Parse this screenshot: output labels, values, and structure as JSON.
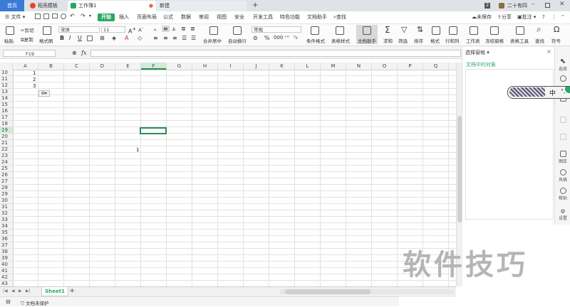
{
  "titlebar": {
    "tabs": [
      {
        "label": "首页"
      },
      {
        "label": "稻壳模板"
      },
      {
        "label": "工作簿1"
      },
      {
        "label": "新建"
      }
    ],
    "tab_count": "2",
    "user_name": "二十有四"
  },
  "menu": {
    "file_label": "文件",
    "items": [
      "开始",
      "插入",
      "页面布局",
      "公式",
      "数据",
      "审阅",
      "视图",
      "安全",
      "开发工具",
      "特色功能",
      "文档助手"
    ],
    "search_label": "查找",
    "unsaved_label": "未保存",
    "share_label": "分享",
    "comment_label": "批注"
  },
  "toolbar": {
    "paste": "粘贴",
    "cut": "剪切",
    "copy": "复制",
    "format_painter": "格式刷",
    "font_name": "宋体",
    "font_size": "11",
    "merge_center": "合并居中",
    "wrap_text": "自动换行",
    "number_format": "常规",
    "conditional_format": "条件格式",
    "table_style": "表格样式",
    "doc_assistant": "文档助手",
    "sum": "求和",
    "filter": "筛选",
    "sort": "排序",
    "format": "格式",
    "row_col": "行和列",
    "worksheet": "工作表",
    "freeze": "冻结窗格",
    "table_tools": "表格工具",
    "find": "查找",
    "symbol": "符号"
  },
  "formula_bar": {
    "name_box": "F19",
    "fx": "fx",
    "formula": ""
  },
  "grid": {
    "columns": [
      "A",
      "B",
      "C",
      "D",
      "E",
      "F",
      "G",
      "H",
      "I",
      "J",
      "K",
      "L",
      "M",
      "N",
      "O",
      "P",
      "Q"
    ],
    "rows": [
      "10",
      "11",
      "12",
      "13",
      "14",
      "15",
      "16",
      "17",
      "18",
      "19",
      "20",
      "21",
      "22",
      "23",
      "24",
      "25",
      "26",
      "27",
      "28",
      "29",
      "30",
      "31",
      "32",
      "33",
      "34",
      "35",
      "36",
      "37",
      "38",
      "39",
      "40",
      "41",
      "42",
      "43"
    ],
    "cells": [
      {
        "ref": "A10",
        "value": "1"
      },
      {
        "ref": "A11",
        "value": "2"
      },
      {
        "ref": "A12",
        "value": "3"
      },
      {
        "ref": "E22",
        "value": "1"
      }
    ],
    "selected_cell": "F19",
    "selected_column": "F",
    "selected_row": "19"
  },
  "sheets": {
    "active": "Sheet1",
    "add": "+"
  },
  "status": {
    "doc_protect": "文档未保护"
  },
  "side_panel": {
    "title": "选择窗格",
    "subtitle": "文档中的对象",
    "close": "×"
  },
  "side_toolbar": {
    "items": [
      {
        "label": "选择",
        "icon": "cursor-icon"
      },
      {
        "label": "图库",
        "icon": "image-icon"
      },
      {
        "label": "风格",
        "icon": "style-icon"
      },
      {
        "label": "帮助",
        "icon": "help-icon"
      },
      {
        "label": "设置",
        "icon": "gear-icon"
      }
    ]
  },
  "ime": {
    "label": "中"
  },
  "watermark": "软件技巧",
  "colors": {
    "accent_green": "#2aa860",
    "home_tab_blue": "#3b7bd8",
    "selection_border": "#2e8b57"
  }
}
